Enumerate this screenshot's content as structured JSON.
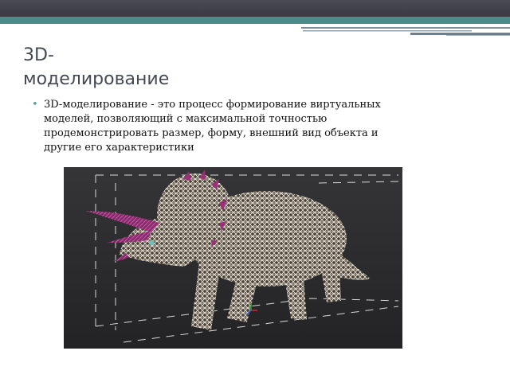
{
  "slide": {
    "title_line_1": "3D-",
    "title_line_2": "моделирование",
    "bullets": [
      "3D-моделирование - это процесс формирование виртуальных моделей, позволяющий с максимальной точностью продемонстрировать размер, форму, внешний вид объекта и другие его характеристики"
    ]
  },
  "image": {
    "subject": "triceratops-3d-wireframe-model",
    "icon": "triceratops-model-image"
  },
  "colors": {
    "header_dark": "#3e3e46",
    "header_teal": "#4f8a8b",
    "title_text": "#444a55",
    "bullet_marker": "#5f9ea0",
    "viewport_bg": "#2b2b2d",
    "horn_color": "#9b2f7a"
  }
}
